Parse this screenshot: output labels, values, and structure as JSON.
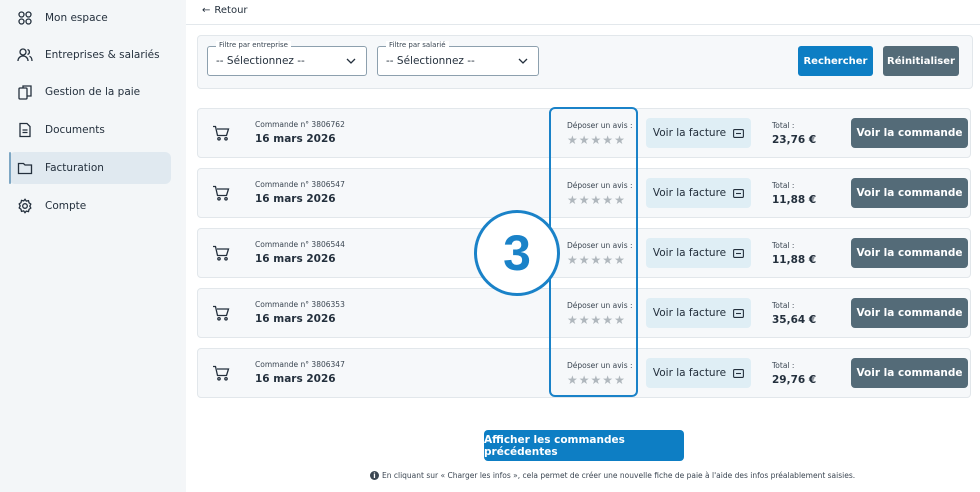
{
  "sidebar": {
    "items": [
      {
        "label": "Mon espace",
        "icon": "dashboard-icon"
      },
      {
        "label": "Entreprises & salariés",
        "icon": "users-icon"
      },
      {
        "label": "Gestion de la paie",
        "icon": "pages-icon"
      },
      {
        "label": "Documents",
        "icon": "document-icon"
      },
      {
        "label": "Facturation",
        "icon": "folder-icon",
        "active": true
      },
      {
        "label": "Compte",
        "icon": "gear-icon"
      }
    ]
  },
  "header": {
    "back_label": "Retour"
  },
  "filters": {
    "company": {
      "label": "Filtre par entreprise",
      "value": "-- Sélectionnez --"
    },
    "employee": {
      "label": "Filtre par salarié",
      "value": "-- Sélectionnez --"
    },
    "search_label": "Rechercher",
    "reset_label": "Réinitialiser"
  },
  "orders": [
    {
      "number": "Commande n° 3806762",
      "date": "16 mars 2026",
      "review_label": "Déposer un avis :",
      "rating": 0,
      "invoice_label": "Voir la facture",
      "total_label": "Total :",
      "total": "23,76 €",
      "view_label": "Voir la commande"
    },
    {
      "number": "Commande n° 3806547",
      "date": "16 mars 2026",
      "review_label": "Déposer un avis :",
      "rating": 0,
      "invoice_label": "Voir la facture",
      "total_label": "Total :",
      "total": "11,88 €",
      "view_label": "Voir la commande"
    },
    {
      "number": "Commande n° 3806544",
      "date": "16 mars 2026",
      "review_label": "Déposer un avis :",
      "rating": 0,
      "invoice_label": "Voir la facture",
      "total_label": "Total :",
      "total": "11,88 €",
      "view_label": "Voir la commande"
    },
    {
      "number": "Commande n° 3806353",
      "date": "16 mars 2026",
      "review_label": "Déposer un avis :",
      "rating": 0,
      "invoice_label": "Voir la facture",
      "total_label": "Total :",
      "total": "35,64 €",
      "view_label": "Voir la commande"
    },
    {
      "number": "Commande n° 3806347",
      "date": "16 mars 2026",
      "review_label": "Déposer un avis :",
      "rating": 0,
      "invoice_label": "Voir la facture",
      "total_label": "Total :",
      "total": "29,76 €",
      "view_label": "Voir la commande"
    }
  ],
  "step_badge": "3",
  "load_more_label": "Afficher les commandes précédentes",
  "info_note": "En cliquant sur « Charger les infos », cela permet de créer une nouvelle fiche de paie à l'aide des infos préalablement saisies.",
  "colors": {
    "accent": "#0d7ec4",
    "dark_button": "#546b78",
    "highlight": "#1a82c8",
    "invoice_bg": "#dfeef5"
  }
}
